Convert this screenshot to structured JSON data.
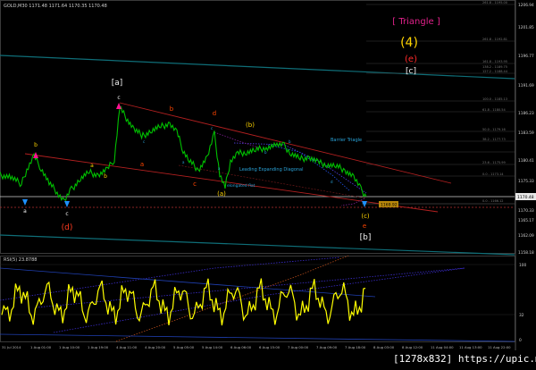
{
  "main": {
    "header": "GOLD,M30  1171.48 1171.64 1170.35 1170.48",
    "axis_prices": [
      "1206.94",
      "1201.85",
      "1196.77",
      "1191.69",
      "1186.23",
      "1183.59",
      "1180.41",
      "1175.33",
      "1170.33",
      "1165.17",
      "1162.09",
      "1158.18"
    ],
    "current_price_tag": "1170.48",
    "low_tag": "1169.92",
    "fib_labels": [
      "261.8 - 1195.00",
      "261.8 - 1192.81",
      "161.8 - 1193.95",
      "138.2 - 1189.75",
      "127.2 - 1188.44",
      "100.0 - 1185.13",
      "61.8 - 1180.54",
      "50.0 - 1179.16",
      "38.2 - 1177.73",
      "23.6 - 1175.99",
      "0.0 - 1173.14",
      "0.0 - 1166.12"
    ],
    "title_triangle": "[ Triangle ]",
    "label_4": "(4)",
    "label_e_paren": "(e)",
    "label_c_bracket": "[c]",
    "label_a_bracket": "[a]",
    "label_b_bracket": "[b]",
    "label_d_paren": "(d)",
    "label_c_paren": "(c)",
    "label_a_paren": "(a)",
    "label_b_paren": "(b)",
    "ann_barrier": "Barrier Triagle",
    "ann_leading": "Leading Expanding Diagonal",
    "ann_elongated": "elongated flat",
    "wave_c_top": "c",
    "wave_b_left": "b",
    "wave_a_orange": "a",
    "wave_b_orange": "b",
    "wave_c_orange": "c",
    "wave_d_orange": "d",
    "wave_e_orange": "e",
    "wave_c_low": "c",
    "wave_a_low": "a",
    "wave_a_yellow": "a",
    "wave_b_yellow": "b"
  },
  "indicator": {
    "header": "RSI(5) 23.8788",
    "axis_values": [
      "100",
      "32",
      "0"
    ]
  },
  "time_axis": [
    "31 Jul 2014",
    "1 Aug 01:00",
    "1 Aug 10:00",
    "1 Aug 19:00",
    "4 Aug 11:00",
    "4 Aug 20:00",
    "5 Aug 05:00",
    "5 Aug 14:00",
    "6 Aug 06:00",
    "6 Aug 15:00",
    "7 Aug 00:00",
    "7 Aug 09:00",
    "7 Aug 18:00",
    "8 Aug 03:00",
    "8 Aug 12:00",
    "11 Aug 04:00",
    "11 Aug 13:00",
    "11 Aug 22:00"
  ],
  "watermark": "[1278x832]  https://upic.me/",
  "colors": {
    "price": "#00c000",
    "orange_wave": "#ff4500",
    "yellow_wave": "#ffd400",
    "magenta": "#ff1493",
    "cyan_arrow": "#1e90ff",
    "rsi_line": "#ffff00"
  }
}
